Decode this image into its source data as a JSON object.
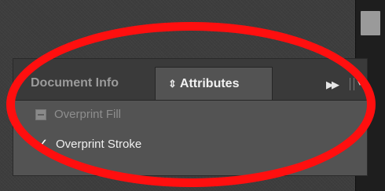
{
  "panel": {
    "tabs": [
      {
        "label": "Document Info",
        "active": false
      },
      {
        "label": "Attributes",
        "active": true
      }
    ],
    "icons": [
      "up-down-arrows-icon",
      "fast-forward-icon",
      "panel-menu-icon"
    ],
    "glyphs": {
      "updown": "⇕",
      "fast_forward": "▶▶",
      "menu": "▾≡",
      "check": "✓"
    },
    "options": [
      {
        "label": "Overprint Fill",
        "state": "indeterminate",
        "enabled": false
      },
      {
        "label": "Overprint Stroke",
        "state": "checked",
        "enabled": true
      }
    ]
  },
  "colors": {
    "highlight_ring": "#ff0f0f",
    "panel_bg": "#535353",
    "tab_bar_bg": "#3a3a3a"
  }
}
